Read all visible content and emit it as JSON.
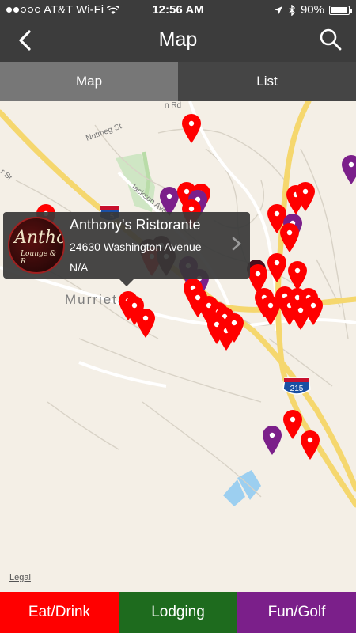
{
  "status_bar": {
    "carrier": "AT&T Wi-Fi",
    "time": "12:56 AM",
    "battery": "90%",
    "battery_level": 0.9,
    "signal_bars_filled": 2,
    "signal_bars_total": 5
  },
  "nav": {
    "title": "Map",
    "back_icon": "chevron-left-icon",
    "search_icon": "search-icon"
  },
  "tabs": [
    {
      "label": "Map",
      "active": true
    },
    {
      "label": "List",
      "active": false
    }
  ],
  "map": {
    "legal_label": "Legal",
    "labels": {
      "city": "Murrieta",
      "street_nutmeg": "Nutmeg St",
      "street_jackson": "Jackson Ave",
      "street_rd": "n Rd",
      "street_st": "r St",
      "shield_15": "15",
      "shield_215": "215"
    },
    "pin_colors": {
      "eat": "#ff0000",
      "fun": "#7b1f8a",
      "dark": "#4a0f1e"
    }
  },
  "callout": {
    "name": "Anthony's Ristorante",
    "address": "24630 Washington Avenue",
    "phone": "N/A",
    "logo_text": "Antho",
    "logo_sub": "Lounge & R"
  },
  "categories": [
    {
      "label": "Eat/Drink",
      "color": "#ff0000"
    },
    {
      "label": "Lodging",
      "color": "#1e6b1e"
    },
    {
      "label": "Fun/Golf",
      "color": "#7b1f8a"
    }
  ]
}
